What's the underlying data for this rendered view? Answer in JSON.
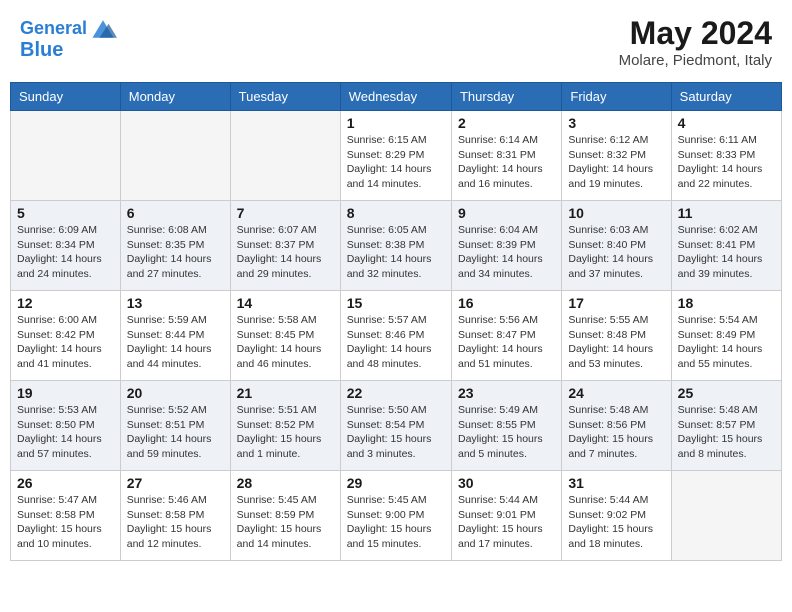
{
  "header": {
    "logo_line1": "General",
    "logo_line2": "Blue",
    "month_title": "May 2024",
    "location": "Molare, Piedmont, Italy"
  },
  "weekdays": [
    "Sunday",
    "Monday",
    "Tuesday",
    "Wednesday",
    "Thursday",
    "Friday",
    "Saturday"
  ],
  "weeks": [
    [
      {
        "day": "",
        "info": ""
      },
      {
        "day": "",
        "info": ""
      },
      {
        "day": "",
        "info": ""
      },
      {
        "day": "1",
        "info": "Sunrise: 6:15 AM\nSunset: 8:29 PM\nDaylight: 14 hours\nand 14 minutes."
      },
      {
        "day": "2",
        "info": "Sunrise: 6:14 AM\nSunset: 8:31 PM\nDaylight: 14 hours\nand 16 minutes."
      },
      {
        "day": "3",
        "info": "Sunrise: 6:12 AM\nSunset: 8:32 PM\nDaylight: 14 hours\nand 19 minutes."
      },
      {
        "day": "4",
        "info": "Sunrise: 6:11 AM\nSunset: 8:33 PM\nDaylight: 14 hours\nand 22 minutes."
      }
    ],
    [
      {
        "day": "5",
        "info": "Sunrise: 6:09 AM\nSunset: 8:34 PM\nDaylight: 14 hours\nand 24 minutes."
      },
      {
        "day": "6",
        "info": "Sunrise: 6:08 AM\nSunset: 8:35 PM\nDaylight: 14 hours\nand 27 minutes."
      },
      {
        "day": "7",
        "info": "Sunrise: 6:07 AM\nSunset: 8:37 PM\nDaylight: 14 hours\nand 29 minutes."
      },
      {
        "day": "8",
        "info": "Sunrise: 6:05 AM\nSunset: 8:38 PM\nDaylight: 14 hours\nand 32 minutes."
      },
      {
        "day": "9",
        "info": "Sunrise: 6:04 AM\nSunset: 8:39 PM\nDaylight: 14 hours\nand 34 minutes."
      },
      {
        "day": "10",
        "info": "Sunrise: 6:03 AM\nSunset: 8:40 PM\nDaylight: 14 hours\nand 37 minutes."
      },
      {
        "day": "11",
        "info": "Sunrise: 6:02 AM\nSunset: 8:41 PM\nDaylight: 14 hours\nand 39 minutes."
      }
    ],
    [
      {
        "day": "12",
        "info": "Sunrise: 6:00 AM\nSunset: 8:42 PM\nDaylight: 14 hours\nand 41 minutes."
      },
      {
        "day": "13",
        "info": "Sunrise: 5:59 AM\nSunset: 8:44 PM\nDaylight: 14 hours\nand 44 minutes."
      },
      {
        "day": "14",
        "info": "Sunrise: 5:58 AM\nSunset: 8:45 PM\nDaylight: 14 hours\nand 46 minutes."
      },
      {
        "day": "15",
        "info": "Sunrise: 5:57 AM\nSunset: 8:46 PM\nDaylight: 14 hours\nand 48 minutes."
      },
      {
        "day": "16",
        "info": "Sunrise: 5:56 AM\nSunset: 8:47 PM\nDaylight: 14 hours\nand 51 minutes."
      },
      {
        "day": "17",
        "info": "Sunrise: 5:55 AM\nSunset: 8:48 PM\nDaylight: 14 hours\nand 53 minutes."
      },
      {
        "day": "18",
        "info": "Sunrise: 5:54 AM\nSunset: 8:49 PM\nDaylight: 14 hours\nand 55 minutes."
      }
    ],
    [
      {
        "day": "19",
        "info": "Sunrise: 5:53 AM\nSunset: 8:50 PM\nDaylight: 14 hours\nand 57 minutes."
      },
      {
        "day": "20",
        "info": "Sunrise: 5:52 AM\nSunset: 8:51 PM\nDaylight: 14 hours\nand 59 minutes."
      },
      {
        "day": "21",
        "info": "Sunrise: 5:51 AM\nSunset: 8:52 PM\nDaylight: 15 hours\nand 1 minute."
      },
      {
        "day": "22",
        "info": "Sunrise: 5:50 AM\nSunset: 8:54 PM\nDaylight: 15 hours\nand 3 minutes."
      },
      {
        "day": "23",
        "info": "Sunrise: 5:49 AM\nSunset: 8:55 PM\nDaylight: 15 hours\nand 5 minutes."
      },
      {
        "day": "24",
        "info": "Sunrise: 5:48 AM\nSunset: 8:56 PM\nDaylight: 15 hours\nand 7 minutes."
      },
      {
        "day": "25",
        "info": "Sunrise: 5:48 AM\nSunset: 8:57 PM\nDaylight: 15 hours\nand 8 minutes."
      }
    ],
    [
      {
        "day": "26",
        "info": "Sunrise: 5:47 AM\nSunset: 8:58 PM\nDaylight: 15 hours\nand 10 minutes."
      },
      {
        "day": "27",
        "info": "Sunrise: 5:46 AM\nSunset: 8:58 PM\nDaylight: 15 hours\nand 12 minutes."
      },
      {
        "day": "28",
        "info": "Sunrise: 5:45 AM\nSunset: 8:59 PM\nDaylight: 15 hours\nand 14 minutes."
      },
      {
        "day": "29",
        "info": "Sunrise: 5:45 AM\nSunset: 9:00 PM\nDaylight: 15 hours\nand 15 minutes."
      },
      {
        "day": "30",
        "info": "Sunrise: 5:44 AM\nSunset: 9:01 PM\nDaylight: 15 hours\nand 17 minutes."
      },
      {
        "day": "31",
        "info": "Sunrise: 5:44 AM\nSunset: 9:02 PM\nDaylight: 15 hours\nand 18 minutes."
      },
      {
        "day": "",
        "info": ""
      }
    ]
  ]
}
